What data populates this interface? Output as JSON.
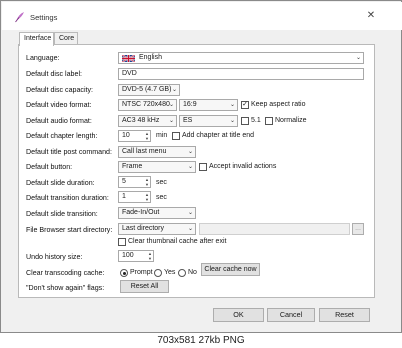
{
  "window": {
    "title": "Settings",
    "close_glyph": "✕"
  },
  "tabs": [
    {
      "label": "Interface",
      "active": true
    },
    {
      "label": "Core",
      "active": false
    }
  ],
  "form": {
    "language": {
      "label": "Language:",
      "value": "English",
      "icon": "uk-flag-icon"
    },
    "disc_label": {
      "label": "Default disc label:",
      "value": "DVD"
    },
    "disc_capacity": {
      "label": "Default disc capacity:",
      "value": "DVD-5 (4.7 GB)"
    },
    "video_format": {
      "label": "Default video format:",
      "format": "NTSC 720x480",
      "aspect": "16:9",
      "keep_aspect_label": "Keep aspect ratio",
      "keep_aspect_checked": true
    },
    "audio_format": {
      "label": "Default audio format:",
      "format": "AC3 48 kHz",
      "language": "ES",
      "surround_label": "5.1",
      "surround_checked": false,
      "normalize_label": "Normalize",
      "normalize_checked": false
    },
    "chapter_length": {
      "label": "Default chapter length:",
      "value": "10",
      "unit": "min",
      "add_chapter_label": "Add chapter at title end",
      "add_chapter_checked": false
    },
    "title_post_command": {
      "label": "Default title post command:",
      "value": "Call last menu"
    },
    "button": {
      "label": "Default button:",
      "value": "Frame",
      "accept_invalid_label": "Accept invalid actions",
      "accept_invalid_checked": false
    },
    "slide_duration": {
      "label": "Default slide duration:",
      "value": "5",
      "unit": "sec"
    },
    "transition_duration": {
      "label": "Default transition duration:",
      "value": "1",
      "unit": "sec"
    },
    "slide_transition": {
      "label": "Default slide transition:",
      "value": "Fade-In/Out"
    },
    "file_browser_dir": {
      "label": "File Browser start directory:",
      "value": "Last directory",
      "browse_label": "...",
      "clear_cache_label": "Clear thumbnail cache after exit",
      "clear_cache_checked": false
    },
    "undo_history": {
      "label": "Undo history size:",
      "value": "100"
    },
    "transcoding_cache": {
      "label": "Clear transcoding cache:",
      "options": [
        "Prompt",
        "Yes",
        "No"
      ],
      "selected": "Prompt",
      "clear_now_label": "Clear cache now"
    },
    "dont_show_again": {
      "label": "\"Don't show again\" flags:",
      "reset_all_label": "Reset All"
    }
  },
  "footer": {
    "ok": "OK",
    "cancel": "Cancel",
    "reset": "Reset"
  },
  "caption": "703x581 27kb PNG",
  "colors": {
    "frame_bg": "#f0f0f0",
    "panel_bg": "#ffffff",
    "button_bg": "#e1e1e1"
  }
}
